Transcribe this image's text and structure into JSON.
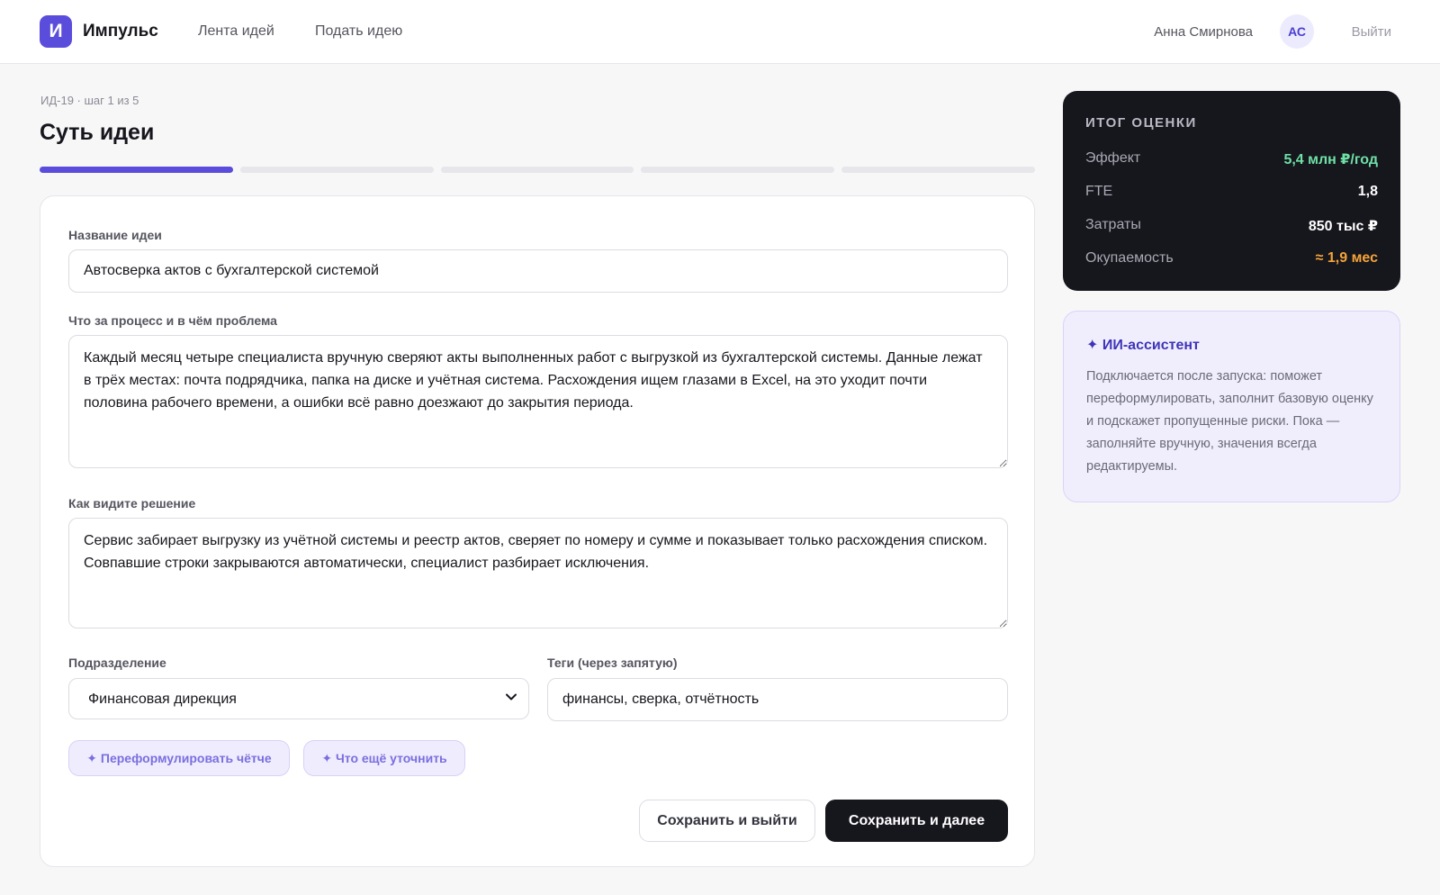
{
  "header": {
    "logo_letter": "И",
    "brand": "Импульс",
    "nav": [
      {
        "label": "Лента идей"
      },
      {
        "label": "Подать идею"
      }
    ],
    "user_name": "Анна Смирнова",
    "avatar_initials": "АС",
    "logout": "Выйти"
  },
  "page": {
    "breadcrumb": "ИД-19 · шаг 1 из 5",
    "title": "Суть идеи",
    "steps_total": 5,
    "steps_active": 1
  },
  "form": {
    "title_label": "Название идеи",
    "title_value": "Автосверка актов с бухгалтерской системой",
    "problem_label": "Что за процесс и в чём проблема",
    "problem_value": "Каждый месяц четыре специалиста вручную сверяют акты выполненных работ с выгрузкой из бухгалтерской системы. Данные лежат в трёх местах: почта подрядчика, папка на диске и учётная система. Расхождения ищем глазами в Excel, на это уходит почти половина рабочего времени, а ошибки всё равно доезжают до закрытия периода.",
    "solution_label": "Как видите решение",
    "solution_value": "Сервис забирает выгрузку из учётной системы и реестр актов, сверяет по номеру и сумме и показывает только расхождения списком. Совпавшие строки закрываются автоматически, специалист разбирает исключения.",
    "dept_label": "Подразделение",
    "dept_value": "Финансовая дирекция",
    "tags_label": "Теги (через запятую)",
    "tags_value": "финансы, сверка, отчётность",
    "chip_reword": "✦ Переформулировать чётче",
    "chip_clarify": "✦ Что ещё уточнить",
    "btn_save_exit": "Сохранить и выйти",
    "btn_save_next": "Сохранить и далее"
  },
  "summary": {
    "title": "ИТОГ ОЦЕНКИ",
    "rows": [
      {
        "label": "Эффект",
        "value": "5,4 млн ₽/год",
        "color": "#6fe0a6"
      },
      {
        "label": "FTE",
        "value": "1,8",
        "color": "#ffffff"
      },
      {
        "label": "Затраты",
        "value": "850 тыс ₽",
        "color": "#ffffff"
      },
      {
        "label": "Окупаемость",
        "value": "≈ 1,9 мес",
        "color": "#f5a43a"
      }
    ]
  },
  "assistant": {
    "title": "✦ ИИ-ассистент",
    "text": "Подключается после запуска: поможет переформулировать, заполнит базовую оценку и подскажет пропущенные риски. Пока — заполняйте вручную, значения всегда редактируемы."
  },
  "colors": {
    "accent": "#5b4ddb",
    "dark": "#16161d",
    "assistant_bg": "#f0eefd"
  }
}
